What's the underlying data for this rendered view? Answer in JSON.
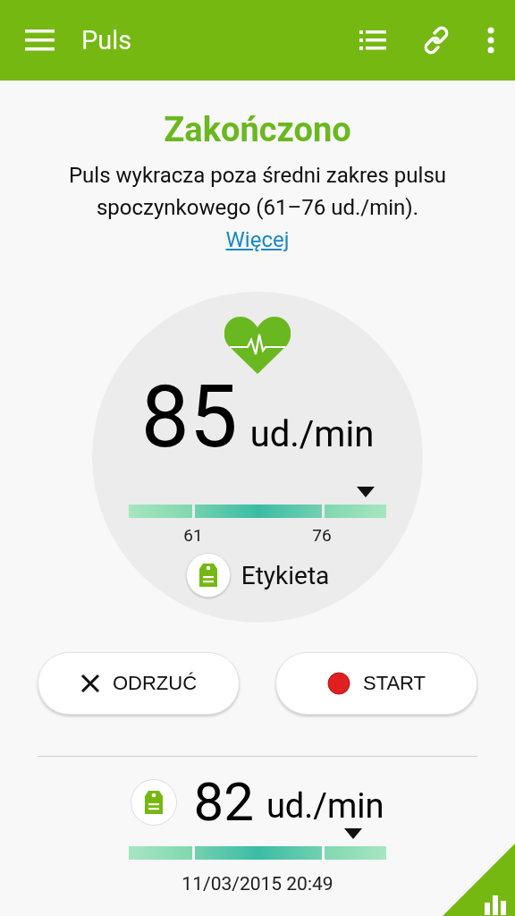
{
  "app_bar": {
    "title": "Puls"
  },
  "result": {
    "status": "Zakończono",
    "message": "Puls wykracza poza średni zakres pulsu spoczynkowego (61–76 ud./min).",
    "more_link": "Więcej"
  },
  "measurement": {
    "value": "85",
    "unit": "ud./min",
    "range_labels": [
      "61",
      "76"
    ],
    "tag_label": "Etykieta"
  },
  "buttons": [
    {
      "kind": "discard",
      "label": "ODRZUĆ"
    },
    {
      "kind": "start",
      "label": "START"
    }
  ],
  "history": {
    "value": "82",
    "unit": "ud./min",
    "timestamp": "11/03/2015 20:49"
  }
}
